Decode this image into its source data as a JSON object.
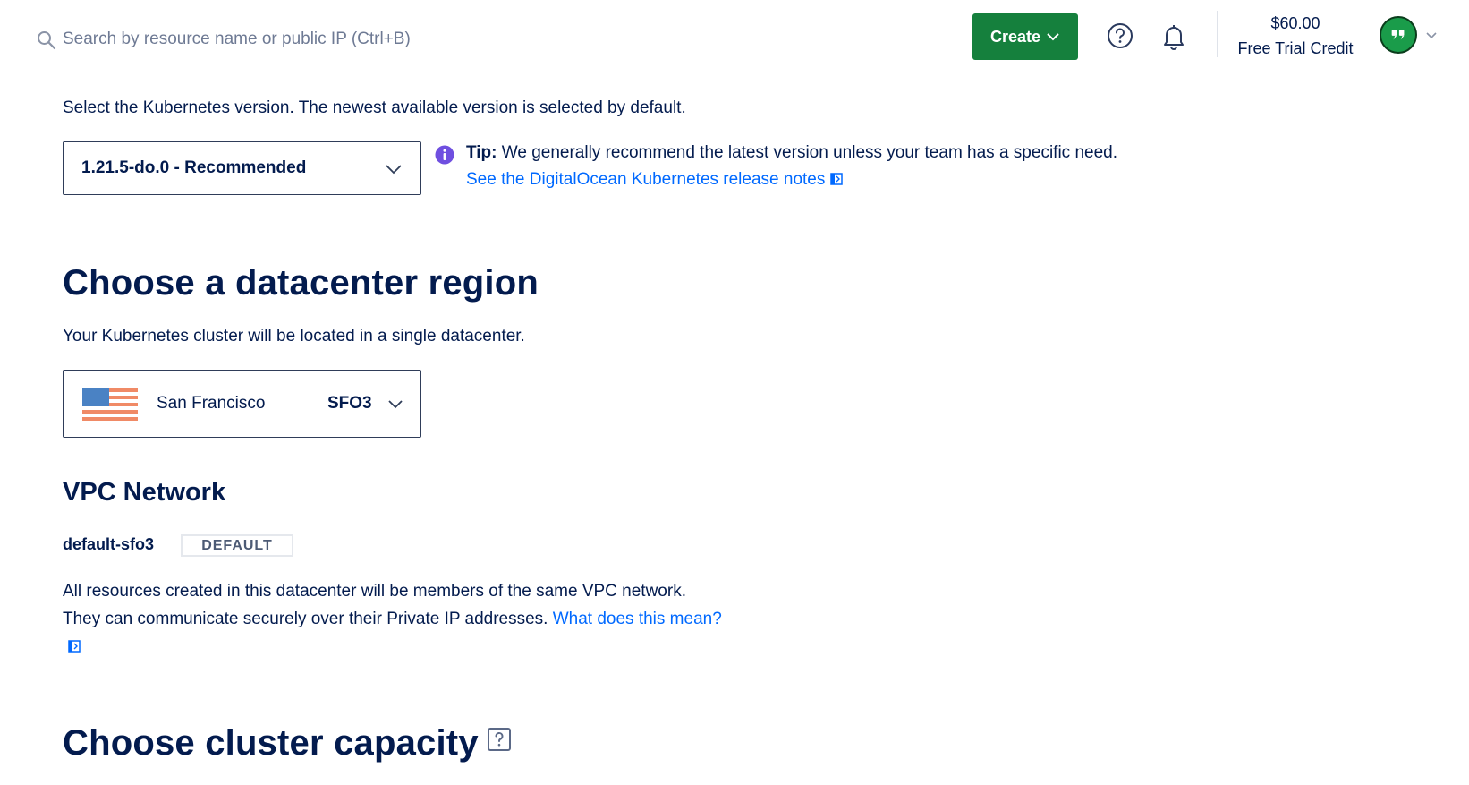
{
  "header": {
    "search": {
      "placeholder": "Search by resource name or public IP (Ctrl+B)",
      "value": ""
    },
    "create_label": "Create",
    "credit_amount": "$60.00",
    "credit_label": "Free Trial Credit"
  },
  "kubernetes_version": {
    "description": "Select the Kubernetes version. The newest available version is selected by default.",
    "selected": "1.21.5-do.0 - Recommended",
    "tip_label": "Tip:",
    "tip_text": " We generally recommend the latest version unless your team has a specific need.",
    "release_notes_link": "See the DigitalOcean Kubernetes release notes"
  },
  "region": {
    "title": "Choose a datacenter region",
    "description": "Your Kubernetes cluster will be located in a single datacenter.",
    "selected_name": "San Francisco",
    "selected_code": "SFO3"
  },
  "vpc": {
    "title": "VPC Network",
    "network_name": "default-sfo3",
    "badge": "DEFAULT",
    "description": "All resources created in this datacenter will be members of the same VPC network. They can communicate securely over their Private IP addresses. ",
    "link": "What does this mean?"
  },
  "capacity": {
    "title": "Choose cluster capacity"
  },
  "colors": {
    "primary_text": "#031b4e",
    "link": "#0069ff",
    "create_button": "#15803d",
    "tip_icon": "#6f4fe0"
  }
}
